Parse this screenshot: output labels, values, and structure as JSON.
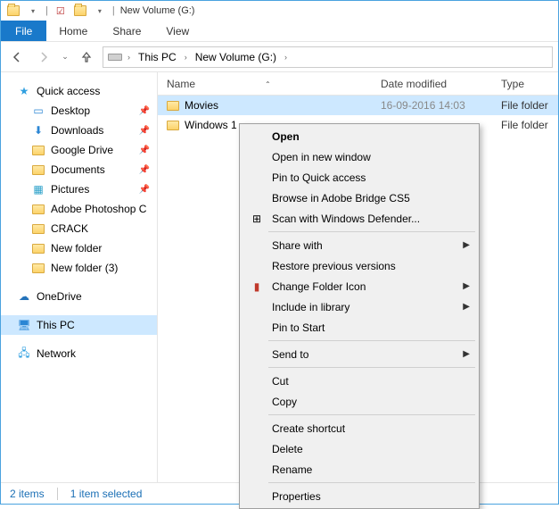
{
  "titlebar": {
    "title": "New Volume (G:)"
  },
  "ribbon": {
    "file": "File",
    "tabs": [
      "Home",
      "Share",
      "View"
    ]
  },
  "address": {
    "root": "This PC",
    "segment": "New Volume (G:)"
  },
  "sidebar": {
    "quick_access": "Quick access",
    "items": [
      {
        "label": "Desktop",
        "pin": true,
        "icon": "desktop"
      },
      {
        "label": "Downloads",
        "pin": true,
        "icon": "downloads"
      },
      {
        "label": "Google Drive",
        "pin": true,
        "icon": "folder"
      },
      {
        "label": "Documents",
        "pin": true,
        "icon": "folder"
      },
      {
        "label": "Pictures",
        "pin": true,
        "icon": "pictures"
      },
      {
        "label": "Adobe Photoshop C",
        "pin": false,
        "icon": "folder"
      },
      {
        "label": "CRACK",
        "pin": false,
        "icon": "folder"
      },
      {
        "label": "New folder",
        "pin": false,
        "icon": "folder"
      },
      {
        "label": "New folder (3)",
        "pin": false,
        "icon": "folder"
      }
    ],
    "onedrive": "OneDrive",
    "thispc": "This PC",
    "network": "Network"
  },
  "columns": {
    "name": "Name",
    "date": "Date modified",
    "type": "Type"
  },
  "rows": [
    {
      "name": "Movies",
      "date": "16-09-2016 14:03",
      "type": "File folder",
      "selected": true
    },
    {
      "name": "Windows 1",
      "date": "",
      "type": "File folder",
      "selected": false
    }
  ],
  "context_menu": {
    "open": "Open",
    "open_new": "Open in new window",
    "pin_qa": "Pin to Quick access",
    "browse_bridge": "Browse in Adobe Bridge CS5",
    "defender": "Scan with Windows Defender...",
    "share_with": "Share with",
    "restore": "Restore previous versions",
    "change_icon": "Change Folder Icon",
    "include_lib": "Include in library",
    "pin_start": "Pin to Start",
    "send_to": "Send to",
    "cut": "Cut",
    "copy": "Copy",
    "shortcut": "Create shortcut",
    "delete": "Delete",
    "rename": "Rename",
    "properties": "Properties"
  },
  "status": {
    "items": "2 items",
    "selected": "1 item selected"
  }
}
